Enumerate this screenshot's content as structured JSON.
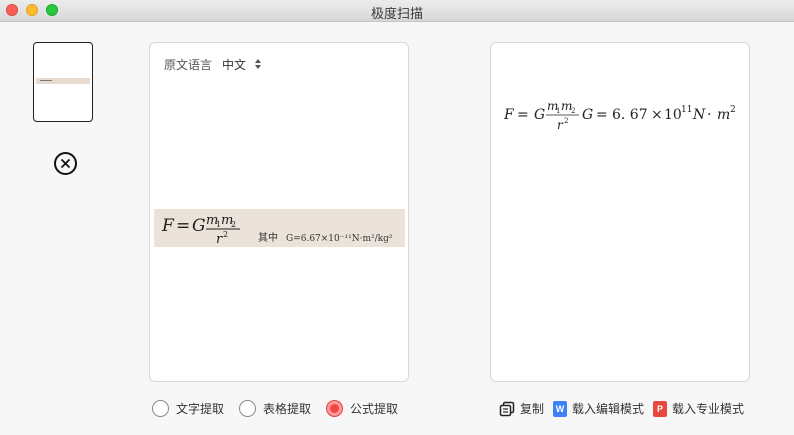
{
  "window": {
    "title": "极度扫描"
  },
  "thumbnail": {
    "caption": ""
  },
  "source": {
    "language_label": "原文语言",
    "language_value": "中文",
    "scan_note_prefix": "其中",
    "scan_note_value": "G=6.67×10⁻¹¹N·m²/kg²"
  },
  "result": {
    "lhs": "F",
    "eq": "=",
    "G": "G",
    "num_m1": "m",
    "num_sub1": "1",
    "num_m2": "m",
    "num_sub2": "2",
    "den_r": "r",
    "den_exp": "2",
    "G2": "G",
    "eq2": "=",
    "value": "6. 67",
    "times": "×",
    "base": "10",
    "exp": "11",
    "unit_n": "N",
    "dot": "·",
    "unit_m": "m",
    "unit_exp": "2"
  },
  "modes": [
    {
      "label": "文字提取",
      "checked": false
    },
    {
      "label": "表格提取",
      "checked": false
    },
    {
      "label": "公式提取",
      "checked": true
    }
  ],
  "actions": {
    "copy": "复制",
    "load_edit": "载入编辑模式",
    "load_pro": "载入专业模式",
    "word_badge": "W",
    "pdf_badge": "P"
  },
  "colors": {
    "accent_red": "#f24545",
    "word_blue": "#3b82f6",
    "pdf_red": "#e8473f"
  }
}
